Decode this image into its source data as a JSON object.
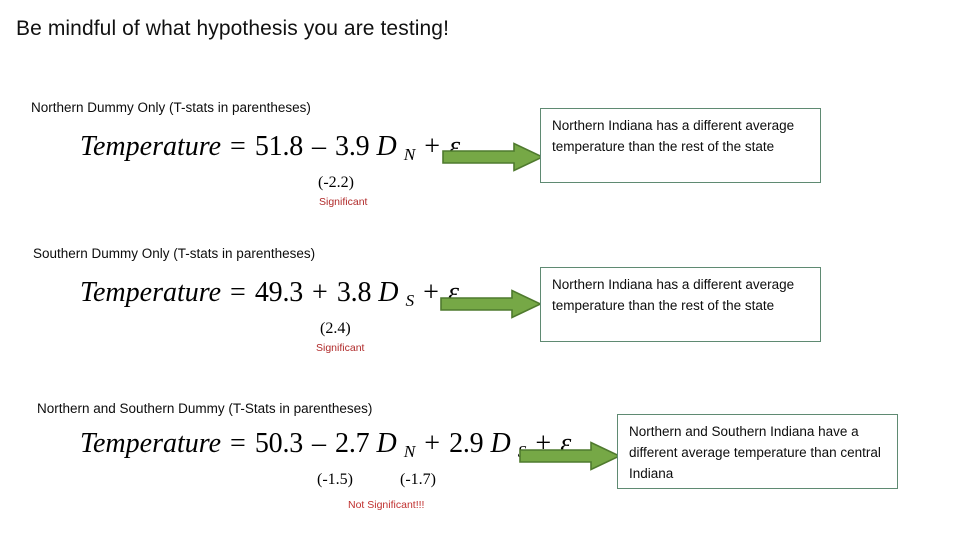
{
  "slide": {
    "title": "Be mindful of what hypothesis you are testing!"
  },
  "accent_colors": {
    "arrow_fill": "#76a846",
    "arrow_outline": "#4f7a2e",
    "box_border": "#5f8a72",
    "significant_text": "#b02a2a",
    "not_significant_text": "#c0302f",
    "body_text": "#0d0d0d"
  },
  "sections": [
    {
      "label": "Northern Dummy Only (T-stats in parentheses)",
      "equation": {
        "lhs": "Temperature",
        "equals": "=",
        "intercept": "51.8",
        "term1_op": "–",
        "term1_coef": "3.9",
        "term1_var": "D",
        "term1_sub": "N",
        "error_op": "+",
        "error": "ε"
      },
      "tstats": [
        {
          "value": "(-2.2)"
        }
      ],
      "significance": "Significant",
      "arrow": "right-block-arrow",
      "callout": "Northern Indiana has a different average temperature than the rest of the state"
    },
    {
      "label": "Southern Dummy Only (T-stats in parentheses)",
      "equation": {
        "lhs": "Temperature",
        "equals": "=",
        "intercept": "49.3",
        "term1_op": "+",
        "term1_coef": "3.8",
        "term1_var": "D",
        "term1_sub": "S",
        "error_op": "+",
        "error": "ε"
      },
      "tstats": [
        {
          "value": "(2.4)"
        }
      ],
      "significance": "Significant",
      "arrow": "right-block-arrow",
      "callout": "Northern Indiana has a different average temperature than the rest of the state"
    },
    {
      "label": "Northern and Southern Dummy (T-Stats in parentheses)",
      "equation": {
        "lhs": "Temperature",
        "equals": "=",
        "intercept": "50.3",
        "term1_op": "–",
        "term1_coef": "2.7",
        "term1_var": "D",
        "term1_sub": "N",
        "term2_op": "+",
        "term2_coef": "2.9",
        "term2_var": "D",
        "term2_sub": "S",
        "error_op": "+",
        "error": "ε"
      },
      "tstats": [
        {
          "value": "(-1.5)"
        },
        {
          "value": "(-1.7)"
        }
      ],
      "significance": "Not Significant!!!",
      "arrow": "right-block-arrow",
      "callout": "Northern and Southern Indiana have a different average temperature than central Indiana"
    }
  ]
}
